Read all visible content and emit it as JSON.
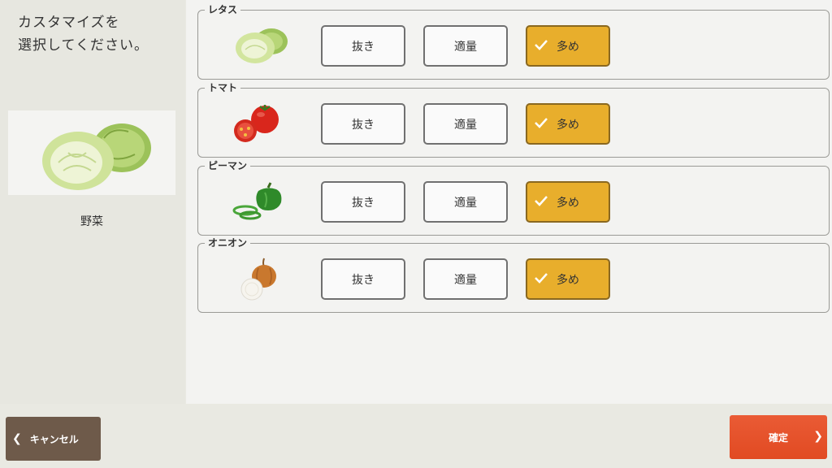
{
  "instruction": {
    "line1": "カスタマイズを",
    "line2": "選択してください。"
  },
  "category": {
    "label": "野菜",
    "image_icon": "lettuce-image"
  },
  "options_default_labels": [
    "抜き",
    "適量",
    "多め"
  ],
  "items": [
    {
      "name": "レタス",
      "icon": "lettuce-icon",
      "options": [
        "抜き",
        "適量",
        "多め"
      ],
      "selected": "多め"
    },
    {
      "name": "トマト",
      "icon": "tomato-icon",
      "options": [
        "抜き",
        "適量",
        "多め"
      ],
      "selected": "多め"
    },
    {
      "name": "ピーマン",
      "icon": "green-pepper-icon",
      "options": [
        "抜き",
        "適量",
        "多め"
      ],
      "selected": "多め"
    },
    {
      "name": "オニオン",
      "icon": "onion-icon",
      "options": [
        "抜き",
        "適量",
        "多め"
      ],
      "selected": "多め"
    }
  ],
  "buttons": {
    "cancel": "キャンセル",
    "confirm": "確定"
  },
  "colors": {
    "selected": "#e8ae2c",
    "cancel": "#6e5a4a",
    "confirm": "#e14a22"
  }
}
